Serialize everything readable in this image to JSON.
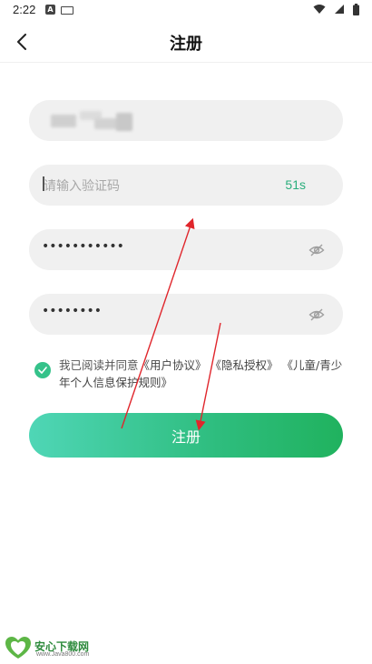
{
  "status_bar": {
    "time": "2:22",
    "notification_letter": "A"
  },
  "header": {
    "title": "注册"
  },
  "form": {
    "code_placeholder": "请输入验证码",
    "countdown": "51s",
    "password_mask": "•••••••••••",
    "confirm_password_mask": "••••••••"
  },
  "agreement": {
    "prefix": "我已阅读并同意",
    "user_agreement": "《用户协议》",
    "privacy": "《隐私授权》",
    "children_rules": "《儿童/青少年个人信息保护规则》"
  },
  "register_button": {
    "label": "注册"
  },
  "watermark": {
    "title": "安心下载网",
    "url": "www.Java800.com"
  },
  "colors": {
    "accent": "#2ebd7e",
    "arrow": "#e0262c"
  },
  "icons": [
    "back-arrow-icon",
    "eye-off-icon",
    "check-icon",
    "wifi-icon",
    "signal-icon",
    "battery-icon"
  ]
}
